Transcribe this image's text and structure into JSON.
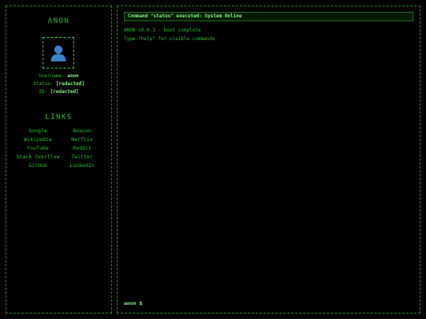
{
  "sidebar": {
    "title": "ANON",
    "avatar_icon": "user-icon",
    "username_label": "Username:",
    "username_value": "anon",
    "status_label": "Status:",
    "status_value": "[redacted]",
    "id_label": "ID:",
    "id_value": "[redacted]",
    "links_title": "LINKS",
    "links": [
      {
        "label": "Google"
      },
      {
        "label": "Amazon"
      },
      {
        "label": "Wikipedia"
      },
      {
        "label": "Netflix"
      },
      {
        "label": "YouTube"
      },
      {
        "label": "Reddit"
      },
      {
        "label": "Stack Overflow"
      },
      {
        "label": "Twitter"
      },
      {
        "label": "GitHub"
      },
      {
        "label": "LinkedIn"
      }
    ]
  },
  "terminal": {
    "banner": "Command \"status\" executed: System Online",
    "output": [
      "ANON v0.0.3 - boot complete",
      "Type \"help\" for visible commands"
    ],
    "prompt": "anon $",
    "input_value": ""
  },
  "colors": {
    "background": "#000000",
    "text": "#22c322",
    "highlight": "#7dff7d",
    "border": "#1f8f1f"
  }
}
